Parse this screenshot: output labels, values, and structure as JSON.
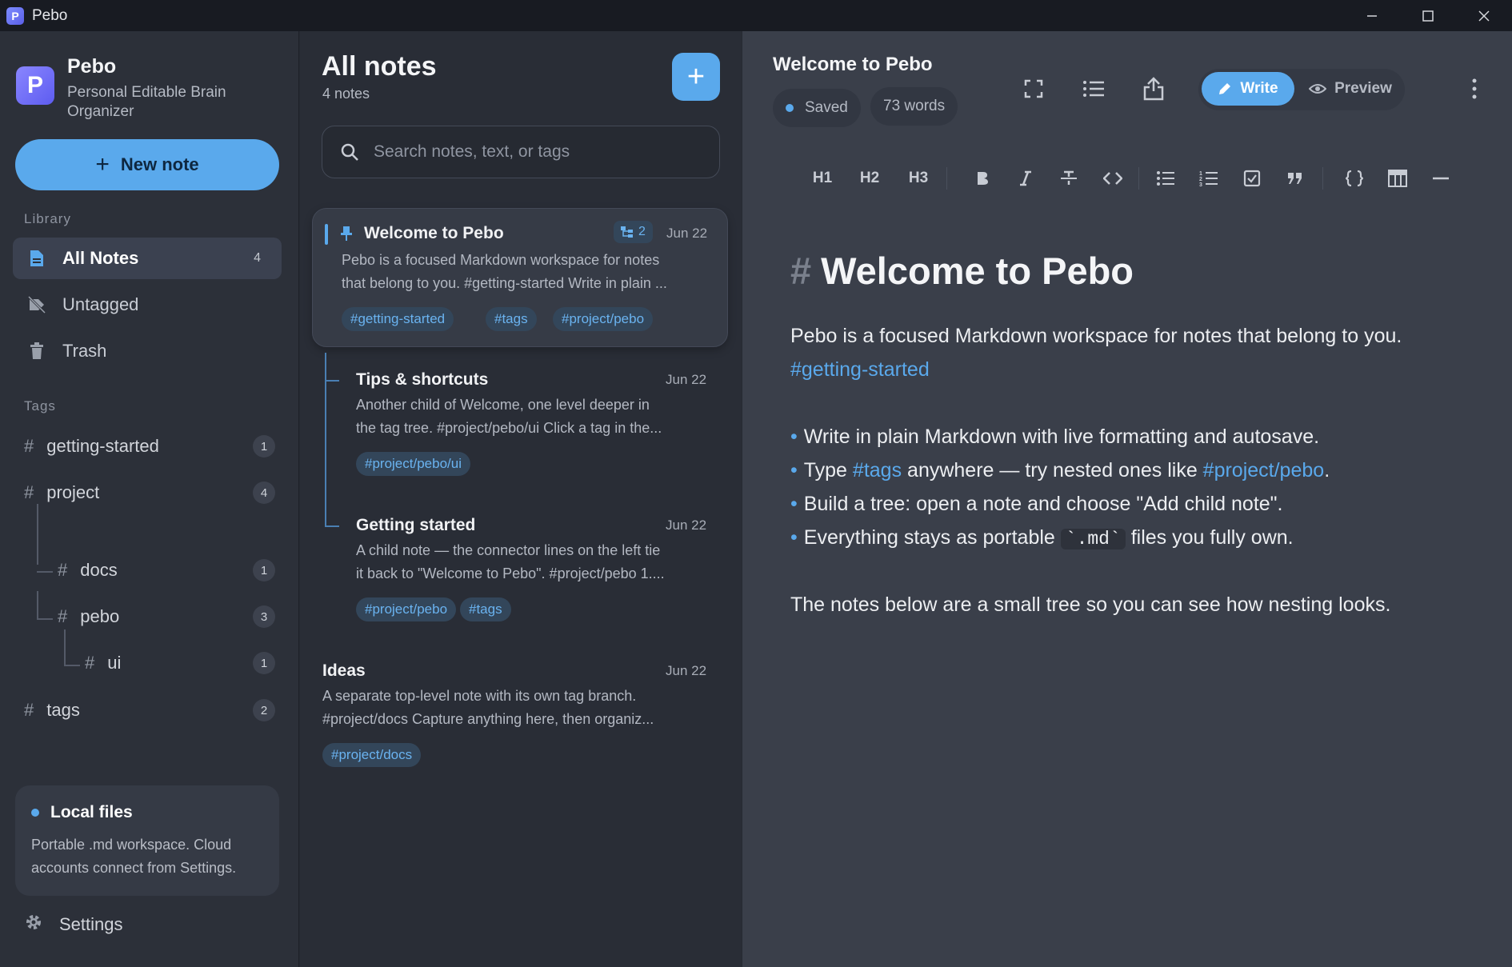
{
  "window": {
    "title": "Pebo",
    "app_icon_letter": "P"
  },
  "sidebar": {
    "brand": {
      "name": "Pebo",
      "tagline_line1": "Personal Editable Brain",
      "tagline_line2": "Organizer",
      "logo_letter": "P"
    },
    "new_note_label": "New note",
    "library_label": "Library",
    "nav": [
      {
        "label": "All Notes",
        "count": "4",
        "icon": "document-icon"
      },
      {
        "label": "Untagged",
        "icon": "tag-off-icon"
      },
      {
        "label": "Trash",
        "icon": "trash-icon"
      }
    ],
    "tags_label": "Tags",
    "tags": [
      {
        "name": "getting-started",
        "count": "1"
      },
      {
        "name": "project",
        "count": "4"
      },
      {
        "name": "docs",
        "count": "1"
      },
      {
        "name": "pebo",
        "count": "3"
      },
      {
        "name": "ui",
        "count": "1"
      },
      {
        "name": "tags",
        "count": "2"
      }
    ],
    "local": {
      "title": "Local files",
      "desc_line1": "Portable .md workspace. Cloud",
      "desc_line2": "accounts connect from Settings."
    },
    "settings_label": "Settings"
  },
  "notes": {
    "title": "All notes",
    "count": "4 notes",
    "search_placeholder": "Search notes, text, or tags",
    "items": [
      {
        "title": "Welcome to Pebo",
        "date": "Jun 22",
        "children": "2",
        "snippet1": "Pebo is a focused Markdown workspace for notes",
        "snippet2": "that belong to you. #getting-started  Write in plain ...",
        "tags": [
          "#getting-started",
          "#tags",
          "#project/pebo"
        ]
      },
      {
        "title": "Tips & shortcuts",
        "date": "Jun 22",
        "snippet1": "Another child of Welcome, one level deeper in",
        "snippet2": "the tag tree. #project/pebo/ui  Click a tag in the...",
        "tags": [
          "#project/pebo/ui"
        ]
      },
      {
        "title": "Getting started",
        "date": "Jun 22",
        "snippet1": "A child note — the connector lines on the left tie",
        "snippet2": "it back to \"Welcome to Pebo\". #project/pebo  1....",
        "tags": [
          "#project/pebo",
          "#tags"
        ]
      },
      {
        "title": "Ideas",
        "date": "Jun 22",
        "snippet1": "A separate top-level note with its own tag branch.",
        "snippet2": "#project/docs  Capture anything here, then organiz...",
        "tags": [
          "#project/docs"
        ]
      }
    ]
  },
  "editor": {
    "title": "Welcome to Pebo",
    "status": "Saved",
    "words": "73 words",
    "write_label": "Write",
    "preview_label": "Preview",
    "toolbar": [
      "H1",
      "H2",
      "H3"
    ],
    "doc": {
      "h1": "Welcome to Pebo",
      "h1_mark": "#",
      "p1": "Pebo is a focused Markdown workspace for notes that belong to you.",
      "p1_tag": "#getting-started",
      "b1": "Write in plain Markdown with live formatting and autosave.",
      "b2_pre": "Type ",
      "b2_tag1": "#tags",
      "b2_mid": " anywhere — try nested ones like ",
      "b2_tag2": "#project/pebo",
      "b2_post": ".",
      "b3": "Build a tree: open a note and choose \"Add child note\".",
      "b4_pre": "Everything stays as portable ",
      "b4_code": "`.md`",
      "b4_post": " files you fully own.",
      "p2": "The notes below are a small tree so you can see how nesting looks."
    }
  },
  "colors": {
    "accent": "#5aa9ec",
    "bg": "#262a33",
    "sidebar": "#2c3039",
    "editor": "#3a3f4a"
  }
}
